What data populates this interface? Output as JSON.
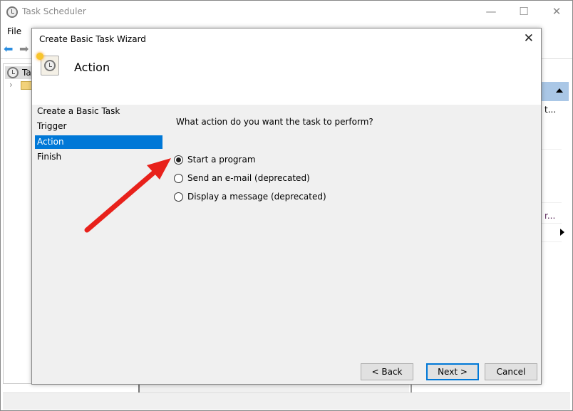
{
  "app": {
    "title": "Task Scheduler",
    "menu": [
      "File"
    ],
    "tree_root": "Task Scheduler"
  },
  "dialog": {
    "title": "Create Basic Task Wizard",
    "heading": "Action",
    "nav": [
      {
        "label": "Create a Basic Task",
        "selected": false
      },
      {
        "label": "Trigger",
        "selected": false
      },
      {
        "label": "Action",
        "selected": true
      },
      {
        "label": "Finish",
        "selected": false
      }
    ],
    "question": "What action do you want the task to perform?",
    "options": [
      {
        "label": "Start a program",
        "checked": true
      },
      {
        "label": "Send an e-mail (deprecated)",
        "checked": false
      },
      {
        "label": "Display a message (deprecated)",
        "checked": false
      }
    ],
    "buttons": {
      "back": "< Back",
      "next": "Next >",
      "cancel": "Cancel"
    }
  },
  "actions_pane": {
    "item1": "t...",
    "item2": "r..."
  },
  "colors": {
    "selection": "#0078d7",
    "annotation_arrow": "#e8211b"
  }
}
